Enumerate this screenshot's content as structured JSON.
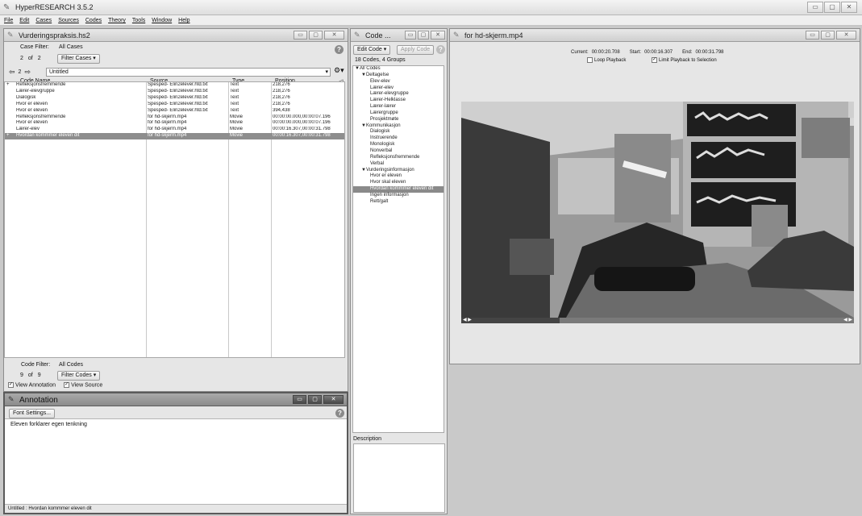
{
  "app": {
    "title": "HyperRESEARCH 3.5.2"
  },
  "menu": [
    "File",
    "Edit",
    "Cases",
    "Sources",
    "Codes",
    "Theory",
    "Tools",
    "Window",
    "Help"
  ],
  "study_window": {
    "title": "Vurderingspraksis.hs2",
    "case_filter_label": "Case Filter:",
    "case_filter_value": "All Cases",
    "case_counter": {
      "current": "2",
      "of": "of",
      "total": "2"
    },
    "filter_cases_button": "Filter Cases",
    "case_nav": {
      "number": "2",
      "name": "Untitled"
    },
    "columns": [
      "Code Name",
      "Source",
      "Type",
      "Position"
    ],
    "rows": [
      {
        "mark": "+",
        "code": "Refleksjonsfremmende",
        "source": "Spesped- Elin2elever.htd.txt",
        "type": "Text",
        "position": "218,276"
      },
      {
        "mark": "",
        "code": "Lærer-elevgruppe",
        "source": "Spesped- Elin2elever.htd.txt",
        "type": "Text",
        "position": "218,276"
      },
      {
        "mark": "",
        "code": "Dialogisk",
        "source": "Spesped- Elin2elever.htd.txt",
        "type": "Text",
        "position": "218,276"
      },
      {
        "mark": "",
        "code": "Hvor er eleven",
        "source": "Spesped- Elin2elever.htd.txt",
        "type": "Text",
        "position": "218,276"
      },
      {
        "mark": "",
        "code": "Hvor er eleven",
        "source": "Spesped- Elin2elever.htd.txt",
        "type": "Text",
        "position": "394,438"
      },
      {
        "mark": "",
        "code": "Refleksjonsfremmende",
        "source": "for hd-skjerm.mp4",
        "type": "Movie",
        "position": "00:00:00.000,00:00:07.196"
      },
      {
        "mark": "",
        "code": "Hvor er eleven",
        "source": "for hd-skjerm.mp4",
        "type": "Movie",
        "position": "00:00:00.000,00:00:07.196"
      },
      {
        "mark": "",
        "code": "Lærer-elev",
        "source": "for hd-skjerm.mp4",
        "type": "Movie",
        "position": "00:00:16.307,00:00:31.798"
      },
      {
        "mark": "+",
        "code": "Hvordan kommmer eleven dit",
        "source": "for hd-skjerm.mp4",
        "type": "Movie",
        "position": "00:00:16.307,00:00:31.798",
        "selected": true
      }
    ],
    "code_filter_label": "Code Filter:",
    "code_filter_value": "All Codes",
    "code_counter": {
      "current": "9",
      "of": "of",
      "total": "9"
    },
    "filter_codes_button": "Filter Codes",
    "view_annotation": "View Annotation",
    "view_source": "View Source"
  },
  "annotation_window": {
    "title": "Annotation",
    "font_settings_button": "Font Settings...",
    "text": "Eleven forklarer egen tenkning",
    "status": "Untitled : Hvordan kommmer eleven dit"
  },
  "code_window": {
    "title": "Code ...",
    "edit_code_button": "Edit Code",
    "apply_code_button": "Apply Code",
    "summary": "18 Codes, 4 Groups",
    "tree": [
      {
        "label": "▼All Codes",
        "level": 0
      },
      {
        "label": "▼Deltagelse",
        "level": 1
      },
      {
        "label": "Elev-elev",
        "level": 2
      },
      {
        "label": "Lærer-elev",
        "level": 2
      },
      {
        "label": "Lærer-elevgruppe",
        "level": 2
      },
      {
        "label": "Lærer-Helklasse",
        "level": 2
      },
      {
        "label": "Lærer-lærer",
        "level": 2
      },
      {
        "label": "Lærergruppe",
        "level": 2
      },
      {
        "label": "Prosjektmøte",
        "level": 2
      },
      {
        "label": "▼Kommunikasjon",
        "level": 1
      },
      {
        "label": "Dialogisk",
        "level": 2
      },
      {
        "label": "Instruerende",
        "level": 2
      },
      {
        "label": "Monologisk",
        "level": 2
      },
      {
        "label": "Nonverbal",
        "level": 2
      },
      {
        "label": "Refleksjonsfremmende",
        "level": 2
      },
      {
        "label": "Verbal",
        "level": 2
      },
      {
        "label": "▼Vurderingsinformasjon",
        "level": 1
      },
      {
        "label": "Hvor er eleven",
        "level": 2
      },
      {
        "label": "Hvor skal eleven",
        "level": 2
      },
      {
        "label": "Hvordan kommmer eleven dit",
        "level": 2,
        "selected": true
      },
      {
        "label": "Ingen informasjon",
        "level": 2
      },
      {
        "label": "Rett/galt",
        "level": 2
      }
    ],
    "description_label": "Description"
  },
  "movie_window": {
    "title": "for hd-skjerm.mp4",
    "current_label": "Current:",
    "current": "00:00:20.708",
    "start_label": "Start:",
    "start": "00:00:16.307",
    "end_label": "End:",
    "end": "00:00:31.798",
    "loop_playback": "Loop Playback",
    "limit_playback": "Limit Playback to Selection",
    "loop_checked": false,
    "limit_checked": true,
    "playback_progress": 0.25
  }
}
